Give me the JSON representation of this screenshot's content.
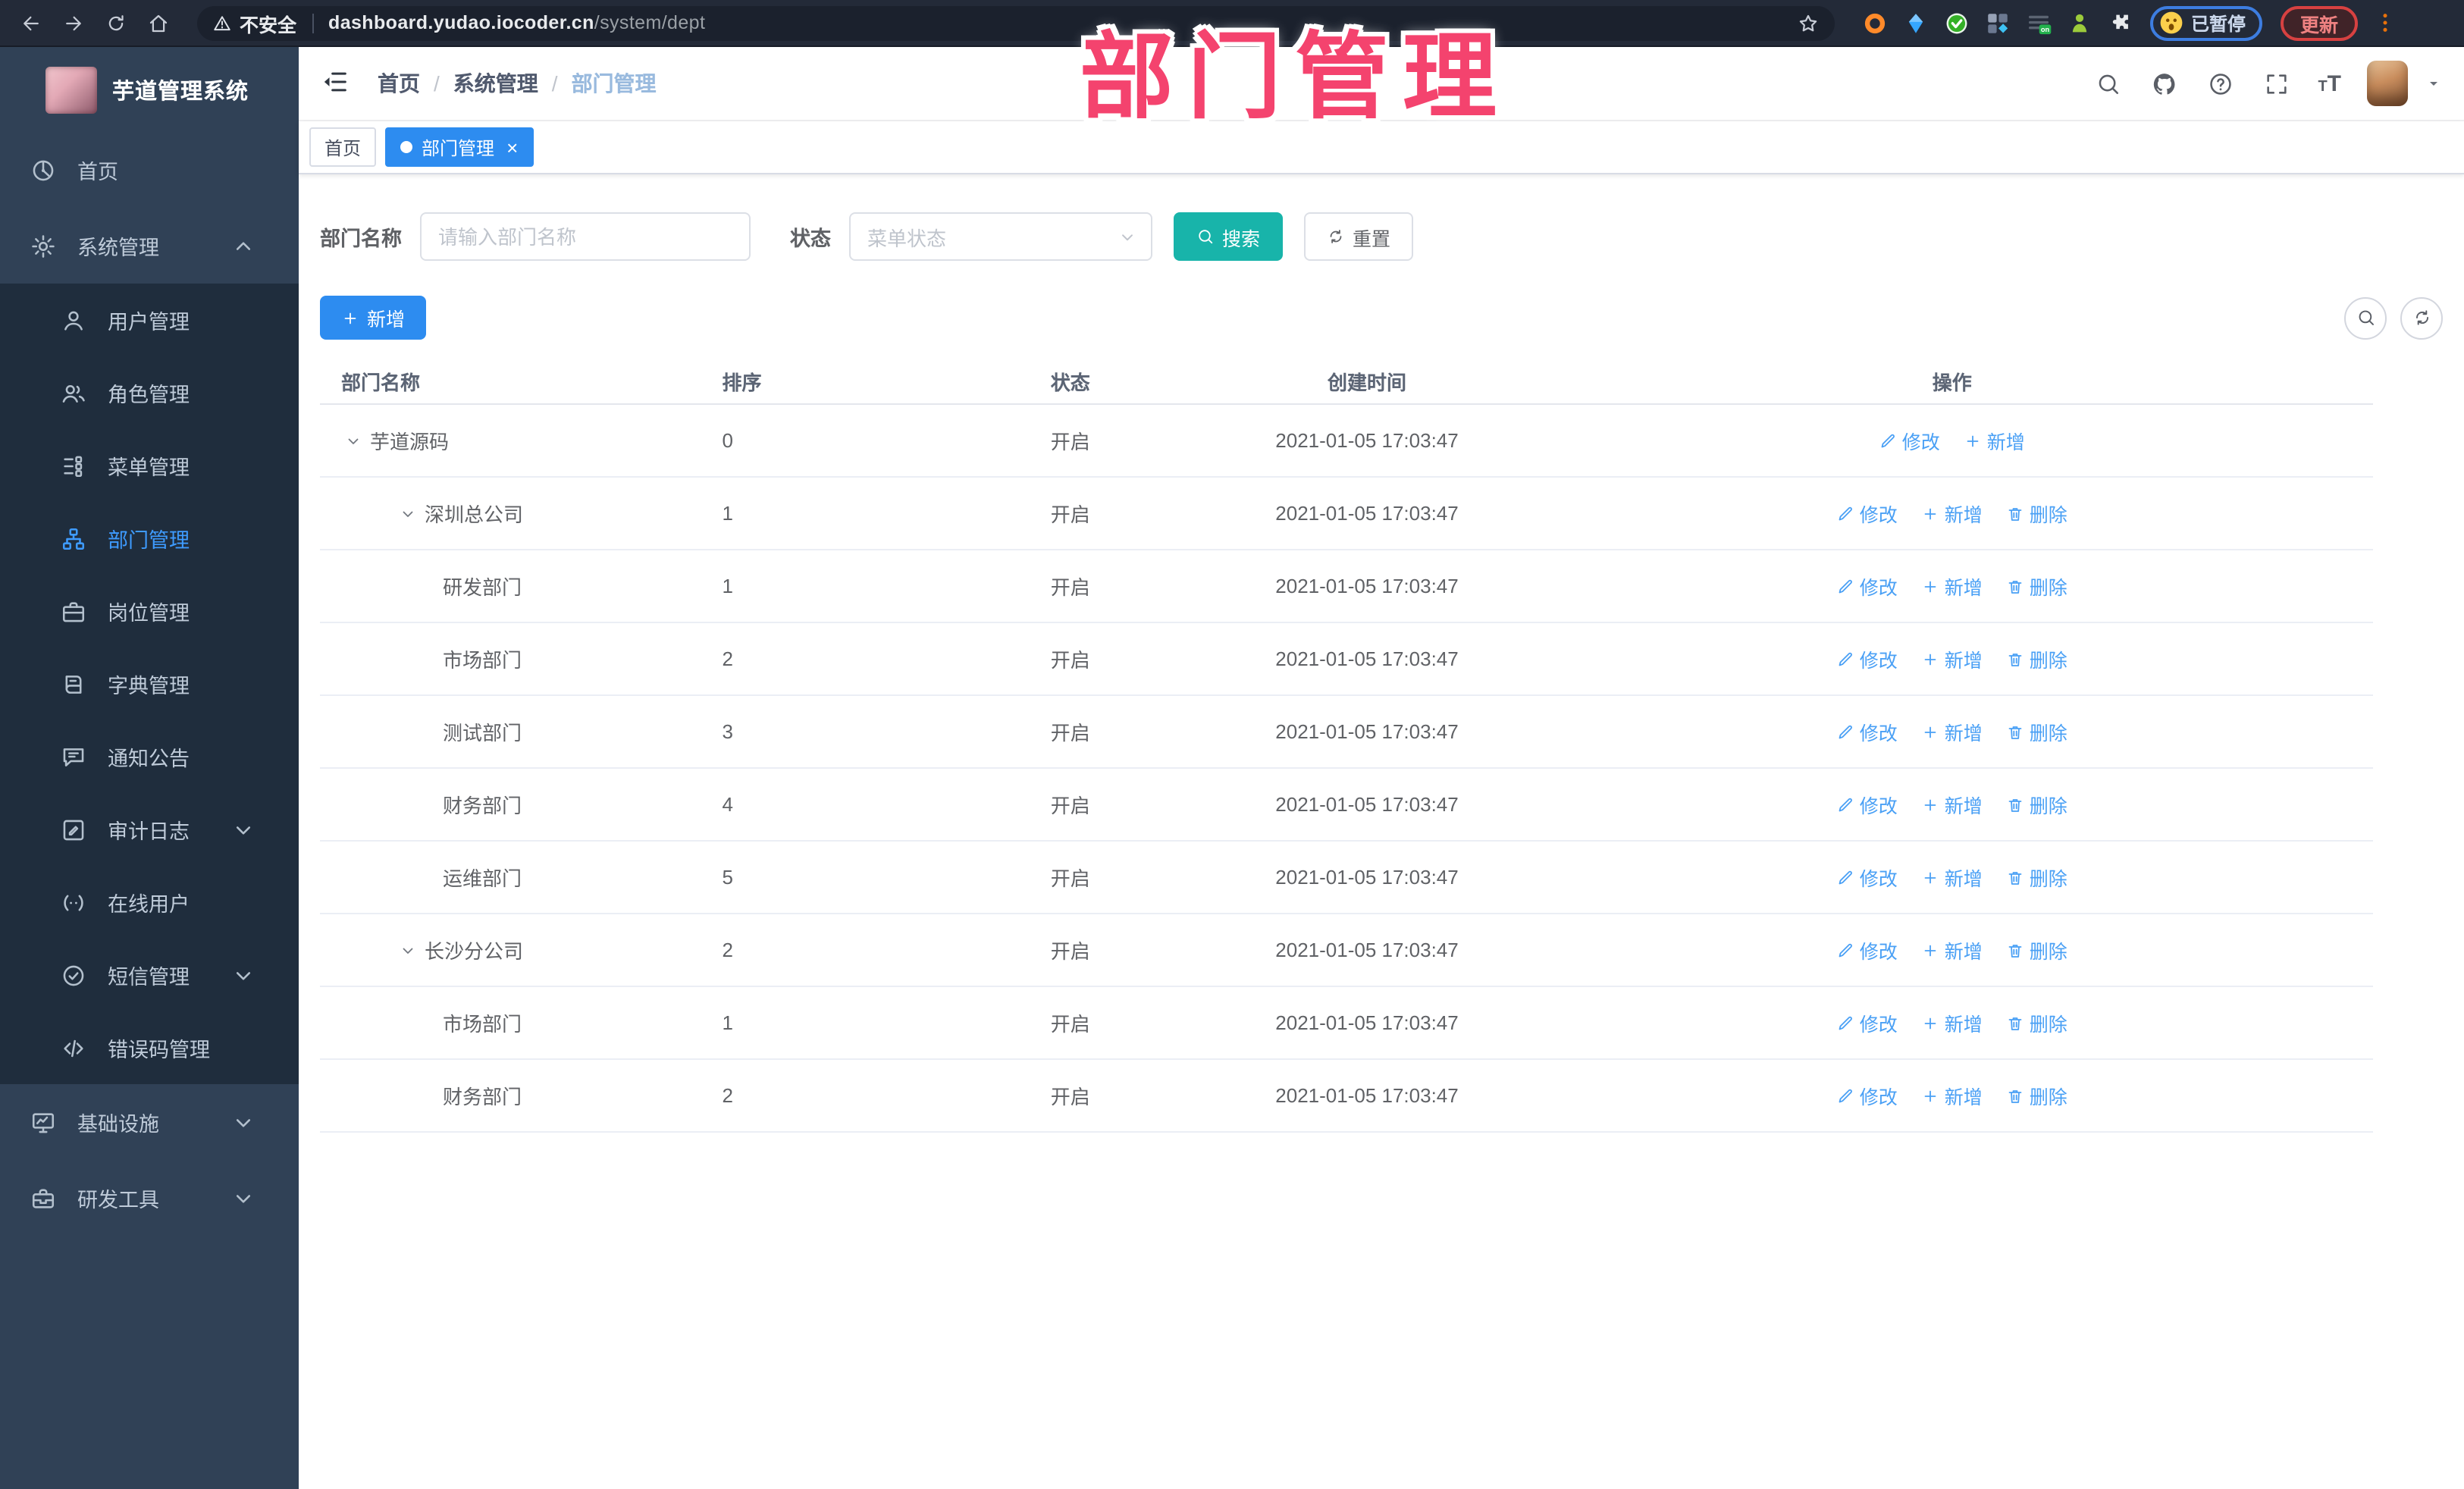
{
  "overlay": {
    "text": "部门管理"
  },
  "browser": {
    "security_label": "不安全",
    "url_host": "dashboard.yudao.iocoder.cn",
    "url_path": "/system/dept",
    "ext_badge": "on",
    "paused_label": "已暂停",
    "update_label": "更新",
    "extensions": [
      "ext-orange",
      "ext-gem",
      "ext-check",
      "ext-grid",
      "ext-onbadge",
      "ext-person",
      "ext-puzzle"
    ]
  },
  "sidebar": {
    "title": "芋道管理系统",
    "items": [
      {
        "label": "首页",
        "icon": "dashboard",
        "kind": "top"
      },
      {
        "label": "系统管理",
        "icon": "gear",
        "kind": "top",
        "chevron": "up"
      },
      {
        "label": "用户管理",
        "icon": "user",
        "kind": "sub"
      },
      {
        "label": "角色管理",
        "icon": "users",
        "kind": "sub"
      },
      {
        "label": "菜单管理",
        "icon": "menu",
        "kind": "sub"
      },
      {
        "label": "部门管理",
        "icon": "org",
        "kind": "sub",
        "active": true
      },
      {
        "label": "岗位管理",
        "icon": "briefcase",
        "kind": "sub"
      },
      {
        "label": "字典管理",
        "icon": "book",
        "kind": "sub"
      },
      {
        "label": "通知公告",
        "icon": "notice",
        "kind": "sub"
      },
      {
        "label": "审计日志",
        "icon": "audit",
        "kind": "sub",
        "chevron": "down"
      },
      {
        "label": "在线用户",
        "icon": "online",
        "kind": "sub"
      },
      {
        "label": "短信管理",
        "icon": "sms",
        "kind": "sub",
        "chevron": "down"
      },
      {
        "label": "错误码管理",
        "icon": "code",
        "kind": "sub"
      },
      {
        "label": "基础设施",
        "icon": "infra",
        "kind": "top",
        "chevron": "down"
      },
      {
        "label": "研发工具",
        "icon": "tools",
        "kind": "top",
        "chevron": "down"
      }
    ]
  },
  "navbar": {
    "breadcrumb": [
      "首页",
      "系统管理",
      "部门管理"
    ]
  },
  "tags": [
    {
      "label": "首页",
      "active": false,
      "closable": false
    },
    {
      "label": "部门管理",
      "active": true,
      "closable": true
    }
  ],
  "filters": {
    "dept_label": "部门名称",
    "dept_placeholder": "请输入部门名称",
    "status_label": "状态",
    "status_placeholder": "菜单状态",
    "search_label": "搜索",
    "reset_label": "重置"
  },
  "toolbar": {
    "add_label": "新增"
  },
  "table": {
    "headers": [
      "部门名称",
      "排序",
      "状态",
      "创建时间",
      "操作"
    ],
    "action_labels": {
      "edit": "修改",
      "add": "新增",
      "delete": "删除"
    },
    "rows": [
      {
        "name": "芋道源码",
        "level": 0,
        "expandable": true,
        "sort": "0",
        "status": "开启",
        "time": "2021-01-05 17:03:47",
        "actions": [
          "edit",
          "add"
        ]
      },
      {
        "name": "深圳总公司",
        "level": 1,
        "expandable": true,
        "sort": "1",
        "status": "开启",
        "time": "2021-01-05 17:03:47",
        "actions": [
          "edit",
          "add",
          "delete"
        ]
      },
      {
        "name": "研发部门",
        "level": 2,
        "expandable": false,
        "sort": "1",
        "status": "开启",
        "time": "2021-01-05 17:03:47",
        "actions": [
          "edit",
          "add",
          "delete"
        ]
      },
      {
        "name": "市场部门",
        "level": 2,
        "expandable": false,
        "sort": "2",
        "status": "开启",
        "time": "2021-01-05 17:03:47",
        "actions": [
          "edit",
          "add",
          "delete"
        ]
      },
      {
        "name": "测试部门",
        "level": 2,
        "expandable": false,
        "sort": "3",
        "status": "开启",
        "time": "2021-01-05 17:03:47",
        "actions": [
          "edit",
          "add",
          "delete"
        ]
      },
      {
        "name": "财务部门",
        "level": 2,
        "expandable": false,
        "sort": "4",
        "status": "开启",
        "time": "2021-01-05 17:03:47",
        "actions": [
          "edit",
          "add",
          "delete"
        ]
      },
      {
        "name": "运维部门",
        "level": 2,
        "expandable": false,
        "sort": "5",
        "status": "开启",
        "time": "2021-01-05 17:03:47",
        "actions": [
          "edit",
          "add",
          "delete"
        ]
      },
      {
        "name": "长沙分公司",
        "level": 1,
        "expandable": true,
        "sort": "2",
        "status": "开启",
        "time": "2021-01-05 17:03:47",
        "actions": [
          "edit",
          "add",
          "delete"
        ]
      },
      {
        "name": "市场部门",
        "level": 2,
        "expandable": false,
        "sort": "1",
        "status": "开启",
        "time": "2021-01-05 17:03:47",
        "actions": [
          "edit",
          "add",
          "delete"
        ]
      },
      {
        "name": "财务部门",
        "level": 2,
        "expandable": false,
        "sort": "2",
        "status": "开启",
        "time": "2021-01-05 17:03:47",
        "actions": [
          "edit",
          "add",
          "delete"
        ]
      }
    ]
  },
  "colors": {
    "accent_blue": "#2d8cf0",
    "link_blue": "#4aa0f5",
    "search_teal": "#18b4aa",
    "annotation_pink": "#f4436e",
    "sidebar_bg": "#304156",
    "submenu_bg": "#1f2d3d",
    "sidebar_active": "#3e9bff"
  }
}
